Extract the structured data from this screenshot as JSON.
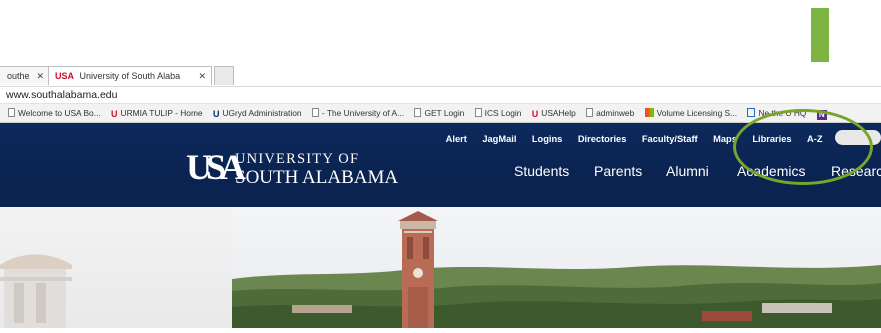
{
  "browser": {
    "tabs": [
      {
        "label": "outhe"
      },
      {
        "label": "University of South Alaba"
      },
      {
        "label": ""
      }
    ],
    "address": "www.southalabama.edu",
    "bookmarks": [
      {
        "label": "Welcome to USA Bo...",
        "icon": "page-icon"
      },
      {
        "label": "URMIA TULIP - Home",
        "icon": "u-logo-icon"
      },
      {
        "label": "UGryd Administration",
        "icon": "u-logo-icon"
      },
      {
        "label": "- The University of A...",
        "icon": "page-icon"
      },
      {
        "label": "GET Login",
        "icon": "page-icon"
      },
      {
        "label": "ICS Login",
        "icon": "page-icon"
      },
      {
        "label": "USAHelp",
        "icon": "usa-logo-icon"
      },
      {
        "label": "adminweb",
        "icon": "page-icon"
      },
      {
        "label": "Volume Licensing S...",
        "icon": "windows-icon"
      },
      {
        "label": "Ne   the U HQ",
        "icon": "calendar-icon"
      },
      {
        "label": "N",
        "icon": "n-icon"
      }
    ]
  },
  "site": {
    "utility_nav": [
      "Alert",
      "JagMail",
      "Logins",
      "Directories",
      "Faculty/Staff",
      "Maps",
      "Libraries",
      "A-Z"
    ],
    "logo": {
      "mark": "USA",
      "line1": "UNIVERSITY OF",
      "line2": "SOUTH ALABAMA"
    },
    "main_nav": [
      "Students",
      "Parents",
      "Alumni",
      "Academics",
      "Research"
    ]
  },
  "colors": {
    "header": "#0a2351",
    "accent_red": "#c8102e",
    "annotation_green": "#7aa52b"
  }
}
